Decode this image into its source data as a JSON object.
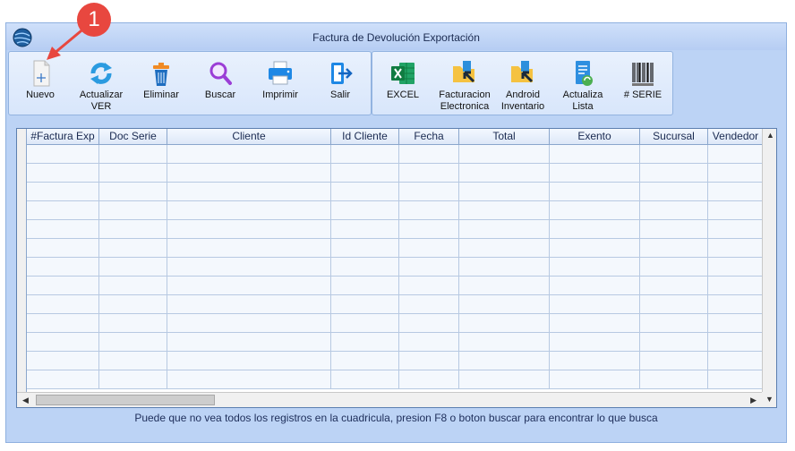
{
  "window": {
    "title": "Factura de Devolución  Exportación"
  },
  "toolbar": {
    "group1": [
      {
        "id": "nuevo",
        "label": "Nuevo",
        "icon": "new-document-icon"
      },
      {
        "id": "actualizar",
        "label": "Actualizar\nVER",
        "icon": "refresh-icon"
      },
      {
        "id": "eliminar",
        "label": "Eliminar",
        "icon": "trash-icon"
      },
      {
        "id": "buscar",
        "label": "Buscar",
        "icon": "search-icon"
      },
      {
        "id": "imprimir",
        "label": "Imprimir",
        "icon": "printer-icon"
      },
      {
        "id": "salir",
        "label": "Salir",
        "icon": "exit-icon"
      }
    ],
    "group2": [
      {
        "id": "excel",
        "label": "EXCEL",
        "icon": "excel-icon"
      },
      {
        "id": "facturacion",
        "label": "Facturacion\nElectronica",
        "icon": "folder-arrow-icon"
      },
      {
        "id": "android",
        "label": "Android\nInventario",
        "icon": "folder-arrow-icon"
      },
      {
        "id": "actualiza-lista",
        "label": "Actualiza\nLista",
        "icon": "list-refresh-icon"
      },
      {
        "id": "serie",
        "label": "# SERIE",
        "icon": "barcode-icon"
      }
    ]
  },
  "grid": {
    "columns": [
      "#Factura Exp",
      "Doc Serie",
      "Cliente",
      "Id Cliente",
      "Fecha",
      "Total",
      "Exento",
      "Sucursal",
      "Vendedor"
    ]
  },
  "status_text": "Puede que no vea todos los registros en la cuadricula, presion F8 o boton buscar para encontrar lo que busca",
  "annotation": {
    "step_number": "1",
    "color": "#e8473f"
  }
}
